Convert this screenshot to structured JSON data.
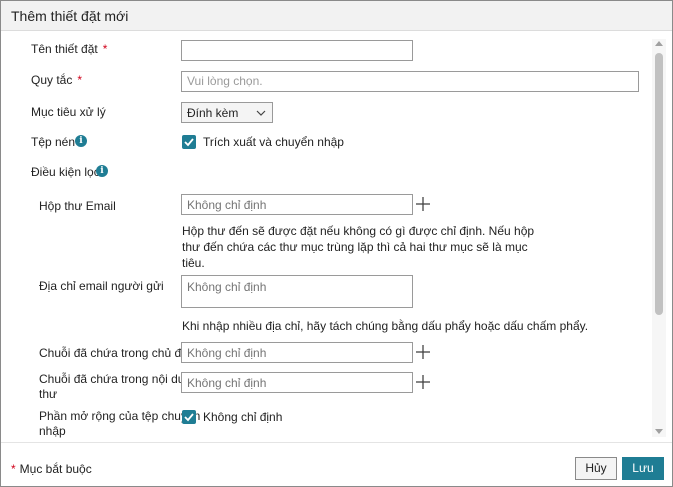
{
  "dialog": {
    "title": "Thêm thiết đặt mới"
  },
  "form": {
    "name": {
      "label": "Tên thiết đặt",
      "required_mark": "*",
      "value": ""
    },
    "rule": {
      "label": "Quy tắc",
      "required_mark": "*",
      "placeholder": "Vui lòng chọn."
    },
    "target": {
      "label": "Mục tiêu xử lý",
      "selected": "Đính kèm"
    },
    "compressed": {
      "label": "Tệp nén",
      "info_glyph": "i",
      "checkbox_label": "Trích xuất và chuyển nhập",
      "checked": true
    },
    "filter": {
      "label": "Điều kiện lọc",
      "info_glyph": "i"
    },
    "mailbox": {
      "label": "Hộp thư Email",
      "placeholder": "Không chỉ định",
      "hint_line1": "Hộp thư đến sẽ được đặt nếu không có gì được chỉ định. Nếu hộp",
      "hint_line2": "thư đến chứa các thư mục trùng lặp thì cả hai thư mục sẽ là mục",
      "hint_line3": "tiêu."
    },
    "sender": {
      "label": "Địa chỉ email người gửi",
      "placeholder": "Không chỉ định",
      "hint": "Khi nhập nhiều địa chỉ, hãy tách chúng bằng dấu phẩy hoặc dấu chấm phẩy."
    },
    "subject": {
      "label": "Chuỗi đã chứa trong chủ đề",
      "placeholder": "Không chỉ định"
    },
    "body_text": {
      "label_line1": "Chuỗi đã chứa trong nội dung",
      "label_line2": "thư",
      "placeholder": "Không chỉ định"
    },
    "extension": {
      "label_line1": "Phần mở rộng của tệp chuyển",
      "label_line2": "nhập",
      "checkbox_label": "Không chỉ định",
      "checked": true
    }
  },
  "footer": {
    "required_star": "*",
    "required_note": "Mục bắt buộc",
    "cancel_label": "Hủy",
    "save_label": "Lưu"
  },
  "colors": {
    "accent": "#1f7d94",
    "required": "#d0021b"
  },
  "icons": {
    "info": "info-icon",
    "plus": "plus-icon",
    "chevron": "chevron-down-icon",
    "check": "checkmark-icon"
  }
}
